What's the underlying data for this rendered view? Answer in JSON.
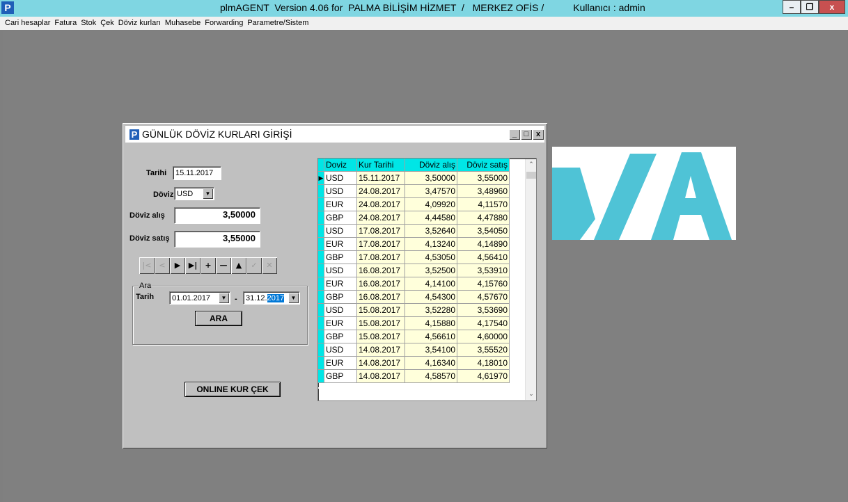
{
  "window": {
    "title": "plmAGENT  Version 4.06 for  PALMA BİLİŞİM HİZMET  /   MERKEZ OFİS /",
    "user": "Kullanıcı : admin",
    "app_icon": "P",
    "minimize": "–",
    "restore": "❐",
    "close": "x"
  },
  "menu": [
    "Cari hesaplar",
    "Fatura",
    "Stok",
    "Çek",
    "Döviz kurları",
    "Muhasebe",
    "Forwarding",
    "Parametre/Sistem"
  ],
  "dialog": {
    "icon": "P",
    "title": "GÜNLÜK DÖVİZ KURLARI GİRİŞİ",
    "min": "_",
    "max": "□",
    "close": "x",
    "tarihi_label": "Tarihi",
    "tarihi_value": "15.11.2017",
    "doviz_label": "Döviz",
    "doviz_value": "USD",
    "alis_label": "Döviz alış",
    "alis_value": "3,50000",
    "satis_label": "Döviz satış",
    "satis_value": "3,55000",
    "navigator": [
      {
        "icon": "first-record-icon",
        "glyph": "|<",
        "enabled": false
      },
      {
        "icon": "prior-record-icon",
        "glyph": "<",
        "enabled": false
      },
      {
        "icon": "next-record-icon",
        "glyph": "▶",
        "enabled": true
      },
      {
        "icon": "last-record-icon",
        "glyph": "▶|",
        "enabled": true
      },
      {
        "icon": "insert-record-icon",
        "glyph": "+",
        "enabled": true
      },
      {
        "icon": "delete-record-icon",
        "glyph": "—",
        "enabled": true
      },
      {
        "icon": "edit-record-icon",
        "glyph": "▲",
        "enabled": true
      },
      {
        "icon": "post-record-icon",
        "glyph": "✓",
        "enabled": false
      },
      {
        "icon": "cancel-record-icon",
        "glyph": "✕",
        "enabled": false
      }
    ],
    "search": {
      "caption": "Ara",
      "tarih_label": "Tarih",
      "from_date": "01.01.2017",
      "to_date_prefix": "31.12.",
      "to_date_selected": "2017",
      "separator": "-",
      "button": "ARA"
    },
    "online_button": "ONLINE KUR ÇEK"
  },
  "grid": {
    "columns": [
      "Doviz",
      "Kur Tarihi",
      "Döviz alış",
      "Döviz satış"
    ],
    "rows": [
      [
        "USD",
        "15.11.2017",
        "3,50000",
        "3,55000"
      ],
      [
        "USD",
        "24.08.2017",
        "3,47570",
        "3,48960"
      ],
      [
        "EUR",
        "24.08.2017",
        "4,09920",
        "4,11570"
      ],
      [
        "GBP",
        "24.08.2017",
        "4,44580",
        "4,47880"
      ],
      [
        "USD",
        "17.08.2017",
        "3,52640",
        "3,54050"
      ],
      [
        "EUR",
        "17.08.2017",
        "4,13240",
        "4,14890"
      ],
      [
        "GBP",
        "17.08.2017",
        "4,53050",
        "4,56410"
      ],
      [
        "USD",
        "16.08.2017",
        "3,52500",
        "3,53910"
      ],
      [
        "EUR",
        "16.08.2017",
        "4,14100",
        "4,15760"
      ],
      [
        "GBP",
        "16.08.2017",
        "4,54300",
        "4,57670"
      ],
      [
        "USD",
        "15.08.2017",
        "3,52280",
        "3,53690"
      ],
      [
        "EUR",
        "15.08.2017",
        "4,15880",
        "4,17540"
      ],
      [
        "GBP",
        "15.08.2017",
        "4,56610",
        "4,60000"
      ],
      [
        "USD",
        "14.08.2017",
        "3,54100",
        "3,55520"
      ],
      [
        "EUR",
        "14.08.2017",
        "4,16340",
        "4,18010"
      ],
      [
        "GBP",
        "14.08.2017",
        "4,58570",
        "4,61970"
      ]
    ],
    "current_row_marker": "▶"
  },
  "colors": {
    "titlebar": "#7fd6e2",
    "grid_header": "#00e6e6",
    "grid_cell": "#ffffdb",
    "logo": "#4fc3d6"
  }
}
